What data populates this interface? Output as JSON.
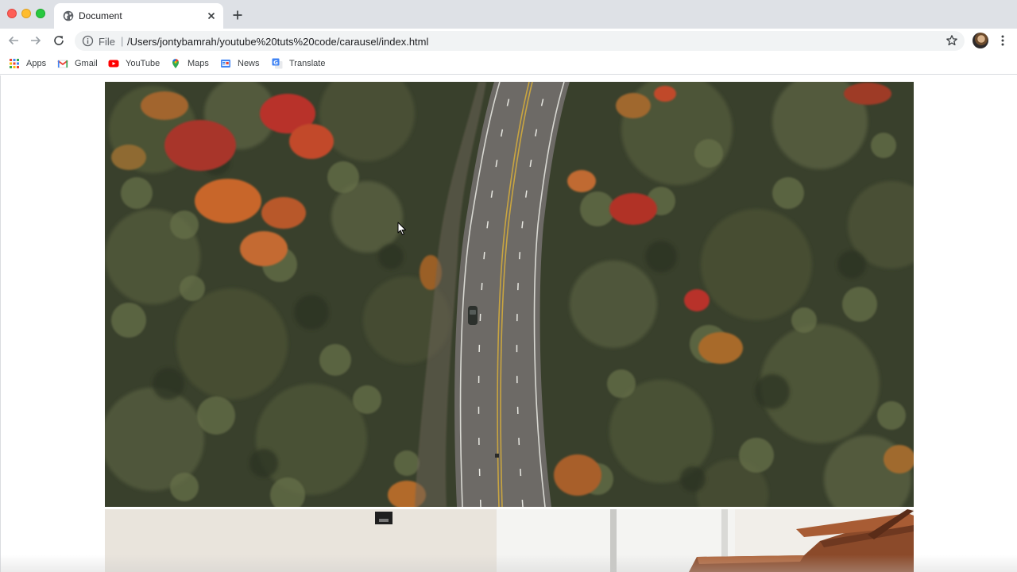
{
  "window": {
    "tab_title": "Document"
  },
  "omnibox": {
    "scheme": "File",
    "separator": "|",
    "url": "/Users/jontybamrah/youtube%20tuts%20code/carausel/index.html"
  },
  "bookmarks": [
    {
      "label": "Apps",
      "icon": "apps-grid-icon"
    },
    {
      "label": "Gmail",
      "icon": "gmail-icon"
    },
    {
      "label": "YouTube",
      "icon": "youtube-icon"
    },
    {
      "label": "Maps",
      "icon": "maps-pin-icon"
    },
    {
      "label": "News",
      "icon": "news-icon"
    },
    {
      "label": "Translate",
      "icon": "translate-icon"
    }
  ],
  "carousel": {
    "slides": [
      {
        "subject": "aerial-forest-road-photo"
      },
      {
        "subject": "interior-piano-photo"
      }
    ]
  },
  "colors": {
    "tabstrip": "#dee1e6",
    "omnibox": "#f1f3f4",
    "foliage_dark": "#3f4630",
    "autumn_orange": "#c8662a",
    "autumn_red": "#b8322a",
    "road": "#6d6a66"
  }
}
